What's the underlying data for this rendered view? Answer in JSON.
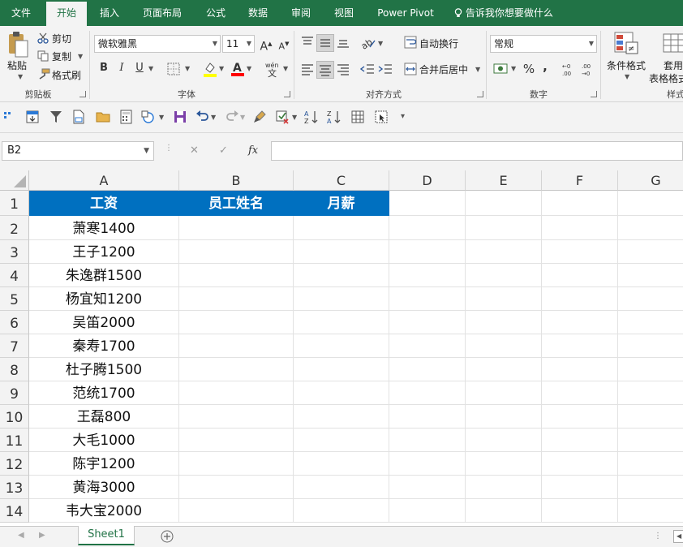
{
  "tabs": [
    "文件",
    "开始",
    "插入",
    "页面布局",
    "公式",
    "数据",
    "审阅",
    "视图",
    "Power Pivot"
  ],
  "tell_me": "告诉我你想要做什么",
  "ribbon": {
    "clipboard": {
      "paste": "粘贴",
      "cut": "剪切",
      "copy": "复制",
      "format_painter": "格式刷",
      "label": "剪贴板"
    },
    "font": {
      "name": "微软雅黑",
      "size": "11",
      "bold": "B",
      "italic": "I",
      "underline": "U",
      "label": "字体"
    },
    "alignment": {
      "wrap": "自动换行",
      "merge": "合并后居中",
      "label": "对齐方式"
    },
    "number": {
      "format": "常规",
      "percent": "%",
      "comma": ",",
      "label": "数字"
    },
    "styles": {
      "conditional": "条件格式",
      "table": "套用\n表格格式",
      "table_line1": "套用",
      "table_line2": "表格格式",
      "label": "样式"
    }
  },
  "formula_bar": {
    "name_box": "B2",
    "cancel": "✕",
    "enter": "✓",
    "fx": "fx",
    "value": ""
  },
  "columns": [
    "A",
    "B",
    "C",
    "D",
    "E",
    "F",
    "G"
  ],
  "rows": [
    "1",
    "2",
    "3",
    "4",
    "5",
    "6",
    "7",
    "8",
    "9",
    "10",
    "11",
    "12",
    "13",
    "14"
  ],
  "header_row": [
    "工资",
    "员工姓名",
    "月薪"
  ],
  "data_a": [
    "萧寒1400",
    "王子1200",
    "朱逸群1500",
    "杨宜知1200",
    "吴笛2000",
    "秦寿1700",
    "杜子腾1500",
    "范统1700",
    "王磊800",
    "大毛1000",
    "陈宇1200",
    "黄海3000",
    "韦大宝2000"
  ],
  "sheet_tab": "Sheet1",
  "colors": {
    "brand": "#217346",
    "header_fill": "#0070c0"
  }
}
